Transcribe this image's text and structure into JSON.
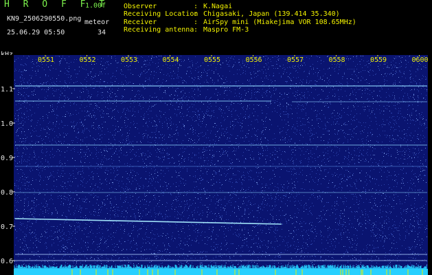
{
  "header": {
    "program_title": "H R O F F T",
    "version": "1.00f",
    "file_name": "KN9_2506290550.png",
    "meteor_label": "meteor",
    "datetime": "25.06.29 05:50",
    "meteor_count": "34"
  },
  "station_info": [
    {
      "label": "Observer",
      "value": "K.Nagai"
    },
    {
      "label": "Receiving Location",
      "value": "Chigasaki, Japan (139.414 35.340)"
    },
    {
      "label": "Receiver",
      "value": "AirSpy mini (Miakejima VOR 108.65MHz)"
    },
    {
      "label": "Receiving antenna",
      "value": "Maspro FM-3"
    }
  ],
  "spectrogram": {
    "y_unit": "kHz",
    "y_ticks": [
      "1.1",
      "1.0",
      "0.9",
      "0.8",
      "0.7",
      "0.6"
    ],
    "time_labels": [
      "0551",
      "0552",
      "0553",
      "0554",
      "0555",
      "0556",
      "0557",
      "0558",
      "0559",
      "0600"
    ],
    "colors": {
      "background": "#0a1470",
      "noise": "#4a6de0",
      "signal": "#9fe0ff",
      "time_label": "#f0f000",
      "baseline": "#27d0ff"
    }
  }
}
